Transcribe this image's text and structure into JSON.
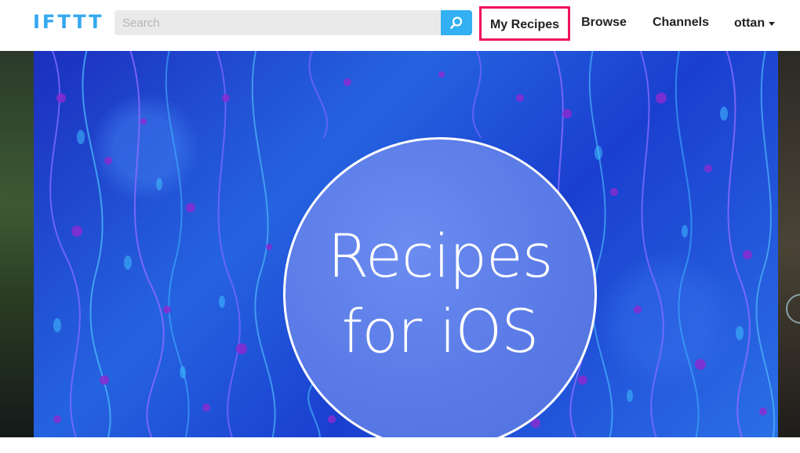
{
  "header": {
    "logo_text": "IFTTT",
    "search": {
      "placeholder": "Search",
      "value": ""
    },
    "nav": {
      "my_recipes": "My Recipes",
      "browse": "Browse",
      "channels": "Channels",
      "user": "ottan"
    }
  },
  "banner": {
    "line1": "Recipes",
    "line2": "for iOS"
  },
  "colors": {
    "brand": "#33a8f0",
    "highlight_border": "#f0125e",
    "search_button": "#33b0f2"
  },
  "icons": {
    "search_button": "search-icon",
    "user_menu": "caret-down-icon"
  }
}
